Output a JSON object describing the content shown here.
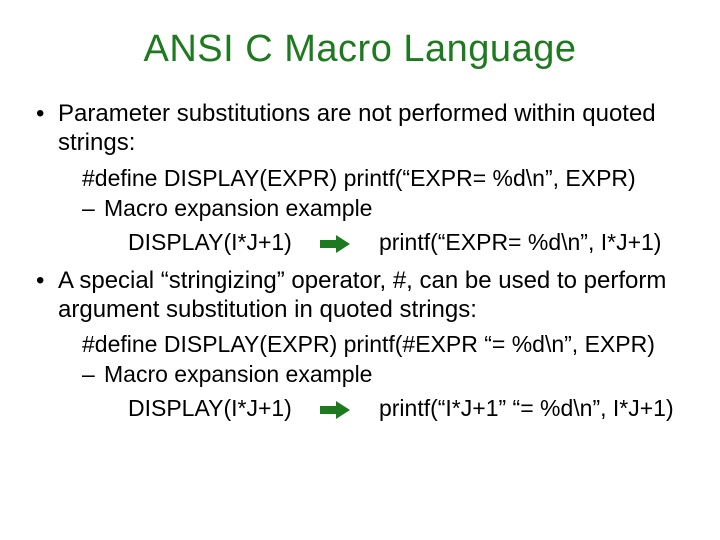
{
  "title_color": "#1E7A1E",
  "arrow_color": "#1E7A1E",
  "title": "ANSI C Macro Language",
  "bullets": [
    {
      "text": "Parameter substitutions are not performed within quoted strings:",
      "code": "#define  DISPLAY(EXPR)   printf(“EXPR= %d\\n”, EXPR)",
      "sub": "Macro expansion example",
      "expansion_left": "DISPLAY(I*J+1)",
      "expansion_right": "printf(“EXPR= %d\\n”, I*J+1)"
    },
    {
      "text": "A special “stringizing” operator, #, can be used to perform argument substitution in quoted strings:",
      "code": "#define  DISPLAY(EXPR)   printf(#EXPR “= %d\\n”, EXPR)",
      "sub": "Macro expansion example",
      "expansion_left": "DISPLAY(I*J+1)",
      "expansion_right": "printf(“I*J+1”  “= %d\\n”, I*J+1)"
    }
  ]
}
